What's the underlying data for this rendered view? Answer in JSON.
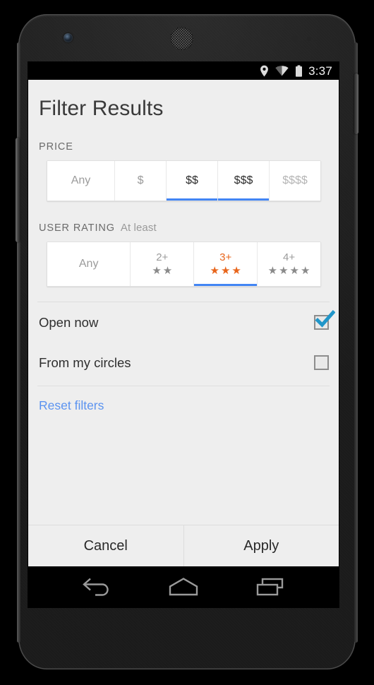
{
  "device": {
    "name": "android-phone",
    "camera_icon": "front-camera",
    "earpiece_icon": "earpiece-speaker",
    "power_button": "power-button",
    "volume_button": "volume-rocker"
  },
  "status_bar": {
    "time": "3:37",
    "icons": [
      "location-pin-icon",
      "wifi-icon",
      "battery-full-icon"
    ],
    "background": "#000000"
  },
  "screen": {
    "title": "Filter Results",
    "background": "#eeeeee"
  },
  "price": {
    "label": "PRICE",
    "options": [
      {
        "label": "Any",
        "state": "unselected"
      },
      {
        "label": "$",
        "state": "unselected"
      },
      {
        "label": "$$",
        "state": "selected"
      },
      {
        "label": "$$$",
        "state": "selected"
      },
      {
        "label": "$$$$",
        "state": "dim"
      }
    ],
    "accent": "#4285f4"
  },
  "user_rating": {
    "label": "USER RATING",
    "sublabel": "At least",
    "options": [
      {
        "label": "Any",
        "stars": 0,
        "state": "unselected"
      },
      {
        "label": "2+",
        "stars": 2,
        "state": "unselected"
      },
      {
        "label": "3+",
        "stars": 3,
        "state": "selected"
      },
      {
        "label": "4+",
        "stars": 4,
        "state": "unselected"
      }
    ],
    "star_glyph": "★",
    "selected_color": "#e8651b",
    "star_color": "#8a8a8a",
    "accent": "#4285f4"
  },
  "toggles": [
    {
      "label": "Open now",
      "checked": true
    },
    {
      "label": "From my circles",
      "checked": false
    }
  ],
  "toggle_rows": {
    "open_now_label": "Open now",
    "from_my_circles_label": "From my circles"
  },
  "reset": {
    "label": "Reset filters",
    "color": "#5b93f0"
  },
  "actions": {
    "cancel_label": "Cancel",
    "apply_label": "Apply"
  },
  "nav_bar": {
    "buttons": [
      "back-icon",
      "home-icon",
      "recents-icon"
    ],
    "background": "#000000"
  }
}
